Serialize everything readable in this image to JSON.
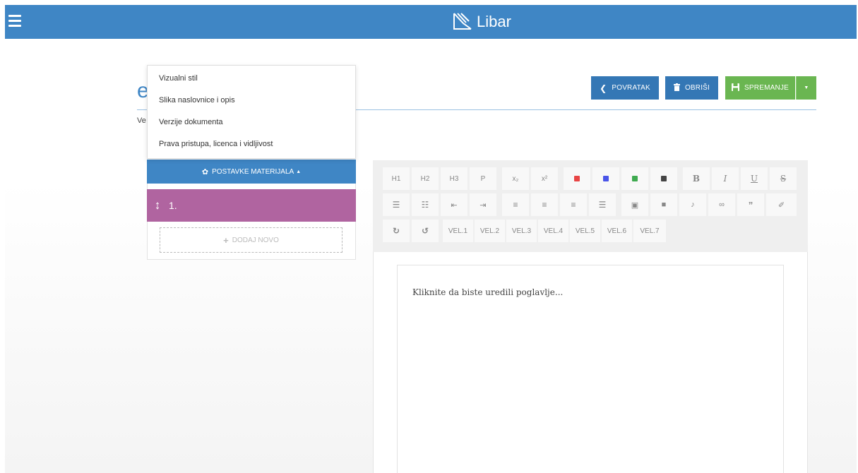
{
  "app": {
    "name": "Libar"
  },
  "page": {
    "title_fragment": "e",
    "subtitle_fragment": "Ve"
  },
  "actions": {
    "back_label": "POVRATAK",
    "delete_label": "OBRIŠI",
    "save_label": "SPREMANJE"
  },
  "settings_menu": {
    "items": [
      "Vizualni stil",
      "Slika naslovnice i opis",
      "Verzije dokumenta",
      "Prava pristupa, licenca i vidljivost"
    ],
    "toggle_label": "POSTAVKE MATERIJALA"
  },
  "chapters": [
    {
      "label": "1."
    }
  ],
  "add_new_label": "DODAJ NOVO",
  "toolbar": {
    "row1": [
      "H1",
      "H2",
      "H3",
      "P",
      "x₂",
      "x²"
    ],
    "colors": [
      "#e84545",
      "#4a55e8",
      "#3faa50",
      "#444444"
    ],
    "formatting": [
      "B",
      "I",
      "U",
      "S"
    ],
    "row3_icons": [
      "redo-icon",
      "undo-icon"
    ],
    "sizes": [
      "VEL.1",
      "VEL.2",
      "VEL.3",
      "VEL.4",
      "VEL.5",
      "VEL.6",
      "VEL.7"
    ]
  },
  "editor": {
    "placeholder": "Kliknite da biste uredili poglavlje..."
  },
  "colors": {
    "primary": "#3f86c5",
    "success": "#6ab651",
    "chapter": "#b064a0"
  }
}
